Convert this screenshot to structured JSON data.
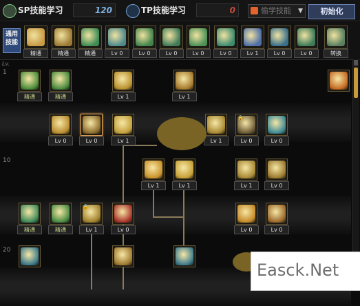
{
  "header": {
    "sp_tab": {
      "label": "SP技能学习",
      "value": "120"
    },
    "tp_tab": {
      "label": "TP技能学习",
      "value": "0"
    },
    "dropdown": {
      "label": "偷学技能",
      "caret": "▼"
    },
    "reset_label": "初始化"
  },
  "quickbar": {
    "common_label": "通用\n技能",
    "slots": [
      {
        "caption": "精通",
        "icon": "pose-skill-icon",
        "color": "#c99b45"
      },
      {
        "caption": "精通",
        "icon": "pose-skill-icon",
        "color": "#9c7a34"
      },
      {
        "caption": "精通",
        "icon": "pose-skill-icon",
        "color": "#3e8c55"
      },
      {
        "caption": "Lv 0",
        "icon": "buff-skill-icon",
        "color": "#4e8a8c"
      },
      {
        "caption": "Lv 0",
        "icon": "aura-skill-icon",
        "color": "#43854d"
      },
      {
        "caption": "Lv 0",
        "icon": "aura-skill-icon",
        "color": "#3f7a59"
      },
      {
        "caption": "Lv 0",
        "icon": "pose-skill-icon",
        "color": "#4e9158"
      },
      {
        "caption": "Lv 0",
        "icon": "pose-skill-icon",
        "color": "#3f8c70"
      },
      {
        "caption": "Lv 1",
        "icon": "eye-skill-icon",
        "color": "#4f6fa8"
      },
      {
        "caption": "Lv 0",
        "icon": "pose-skill-icon",
        "color": "#3a6f8a"
      },
      {
        "caption": "Lv 0",
        "icon": "pose-skill-icon",
        "color": "#3e7c5a"
      },
      {
        "caption": "转换",
        "icon": "swap-skill-icon",
        "color": "#5a8060"
      }
    ]
  },
  "tree": {
    "lv_header": "Lv.",
    "row_labels": [
      "1",
      "10",
      "20"
    ],
    "skills": [
      {
        "caption": "精通",
        "color": "#4c8c3a",
        "locked": false
      },
      {
        "caption": "精通",
        "color": "#4a8a3e",
        "locked": false
      },
      {
        "caption": "Lv 1",
        "color": "#b9902e",
        "locked": false
      },
      {
        "caption": "Lv 1",
        "color": "#a57a2c",
        "locked": false
      },
      {
        "caption": "",
        "color": "#c56a22",
        "locked": false
      },
      {
        "caption": "Lv 0",
        "color": "#b98c30",
        "locked": false
      },
      {
        "caption": "Lv 0",
        "color": "#8d6c2c",
        "locked": false
      },
      {
        "caption": "Lv 1",
        "color": "#c2a03a",
        "locked": false
      },
      {
        "caption": "Lv 1",
        "color": "#a88832",
        "locked": false
      },
      {
        "caption": "Lv 0",
        "color": "#6b5a36",
        "locked": true
      },
      {
        "caption": "Lv 0",
        "color": "#3f8a96",
        "locked": false
      },
      {
        "caption": "Lv 1",
        "color": "#c9922a",
        "locked": false
      },
      {
        "caption": "Lv 1",
        "color": "#c6a036",
        "locked": false
      },
      {
        "caption": "Lv 1",
        "color": "#a88834",
        "locked": false
      },
      {
        "caption": "Lv 0",
        "color": "#9c7a2e",
        "locked": false
      },
      {
        "caption": "精通",
        "color": "#3f8a5a",
        "locked": false
      },
      {
        "caption": "精通",
        "color": "#4a8c42",
        "locked": false
      },
      {
        "caption": "Lv 1",
        "color": "#a0802c",
        "locked": true
      },
      {
        "caption": "Lv 0",
        "color": "#a9342a",
        "locked": false
      },
      {
        "caption": "Lv 0",
        "color": "#c58a28",
        "locked": false
      },
      {
        "caption": "Lv 0",
        "color": "#9c6a2c",
        "locked": false
      },
      {
        "caption": "",
        "color": "#3c7a8a",
        "locked": false
      },
      {
        "caption": "",
        "color": "#a07a30",
        "locked": false
      },
      {
        "caption": "",
        "color": "#3f7c8c",
        "locked": false
      }
    ]
  },
  "watermark": {
    "text": "Easck.Net"
  }
}
